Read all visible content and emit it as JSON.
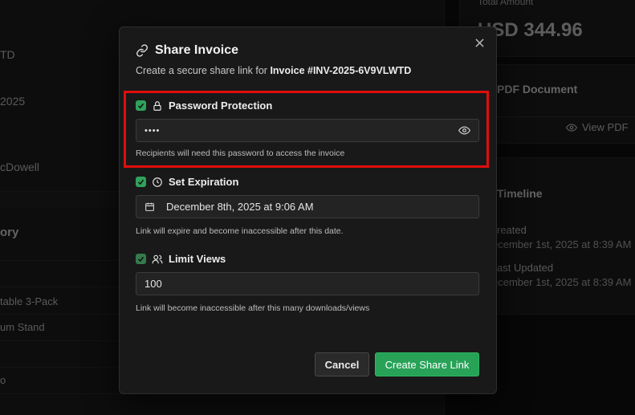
{
  "background": {
    "left_rows": {
      "r1": "TD",
      "r2": "2025",
      "r3": "cDowell",
      "r4": "ory",
      "r5": "table 3-Pack",
      "r6": "um Stand",
      "r7": "o"
    },
    "right": {
      "total_label": "Total Amount",
      "total_value": "USD 344.96",
      "pdf_label": "PDF Document",
      "view_pdf": "View PDF",
      "timeline_label": "Timeline",
      "created_label": "reated",
      "created_value": "ecember 1st, 2025 at 8:39 AM",
      "updated_label": "ast Updated",
      "updated_value": "ecember 1st, 2025 at 8:39 AM"
    }
  },
  "modal": {
    "title": "Share Invoice",
    "subtitle_prefix": "Create a secure share link for ",
    "subtitle_invoice": "Invoice #INV-2025-6V9VLWTD",
    "password": {
      "label": "Password Protection",
      "value": "••••",
      "help": "Recipients will need this password to access the invoice",
      "checked": true
    },
    "expiration": {
      "label": "Set Expiration",
      "value": "December 8th, 2025 at 9:06 AM",
      "help": "Link will expire and become inaccessible after this date.",
      "checked": true
    },
    "views": {
      "label": "Limit Views",
      "value": "100",
      "help": "Link will become inaccessible after this many downloads/views",
      "checked": true
    },
    "cancel_label": "Cancel",
    "create_label": "Create Share Link"
  },
  "colors": {
    "accent_green": "#27a257",
    "highlight_red": "#e10d0d"
  }
}
